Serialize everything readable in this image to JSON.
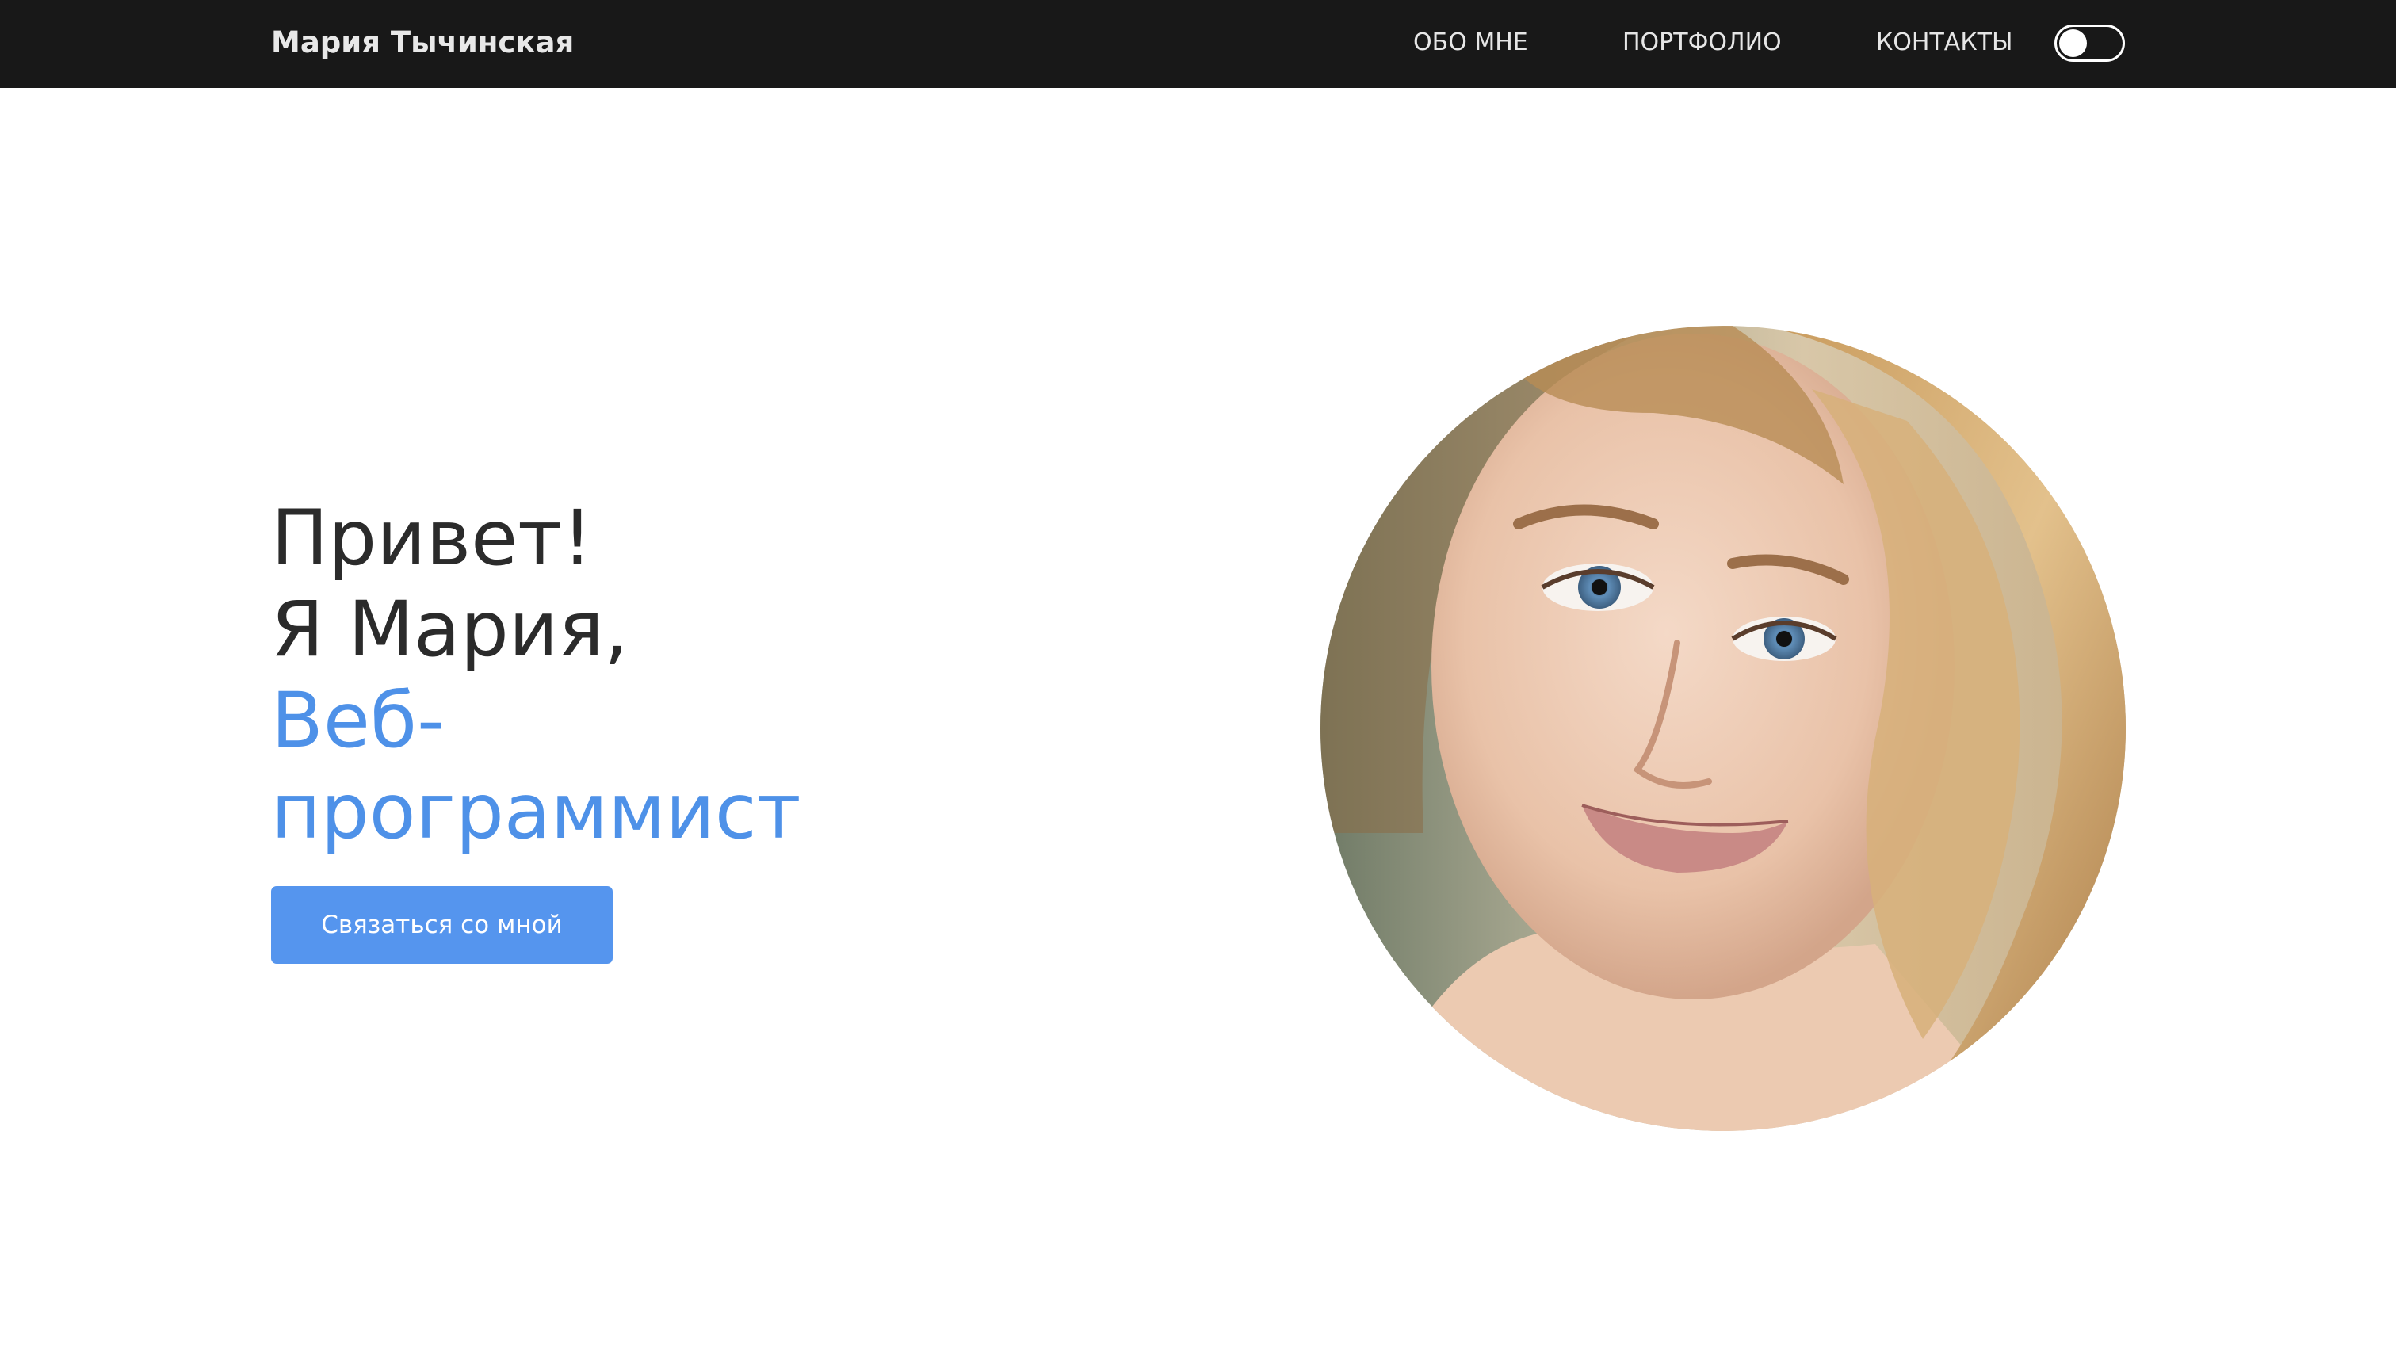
{
  "header": {
    "brand": "Мария Тычинская",
    "nav": {
      "about": "ОБО МНЕ",
      "portfolio": "ПОРТФОЛИО",
      "contacts": "КОНТАКТЫ"
    },
    "theme_toggle": {
      "state": "off"
    }
  },
  "hero": {
    "line1": "Привет!",
    "line2": "Я Мария,",
    "line3": "Веб-",
    "line4": "программист",
    "cta_label": "Связаться со мной",
    "photo_alt": "portrait-photo"
  },
  "colors": {
    "header_bg": "#181818",
    "accent": "#4e91e8",
    "button_bg": "#5595ee",
    "text": "#2b2b2b"
  }
}
